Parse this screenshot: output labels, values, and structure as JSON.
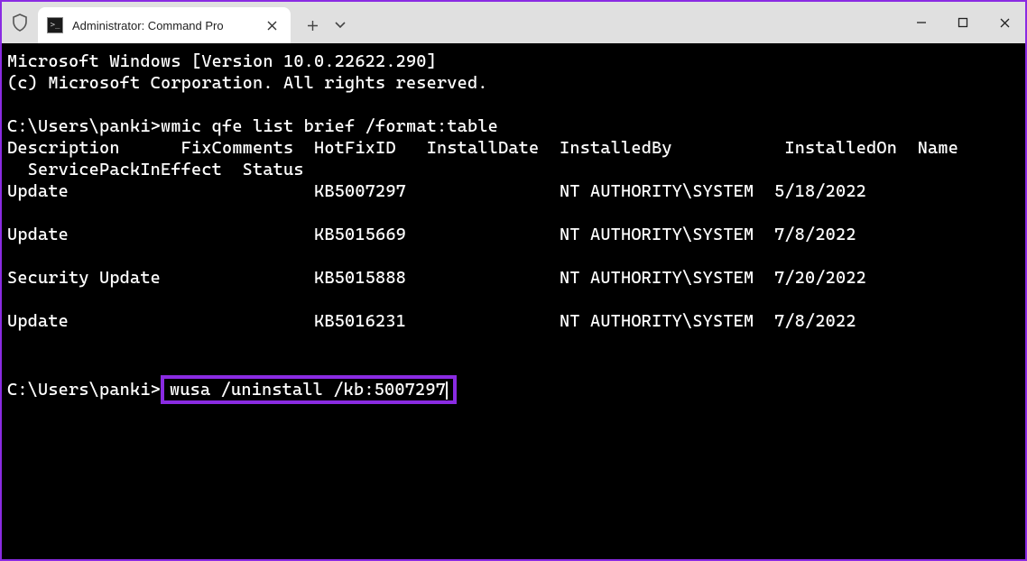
{
  "window": {
    "tab_title": "Administrator: Command Pro",
    "tab_icon": ">_"
  },
  "terminal": {
    "banner1": "Microsoft Windows [Version 10.0.22622.290]",
    "banner2": "(c) Microsoft Corporation. All rights reserved.",
    "prompt1": "C:\\Users\\panki>",
    "command1": "wmic qfe list brief /format:table",
    "headers": {
      "c1": "Description",
      "c2": "FixComments",
      "c3": "HotFixID",
      "c4": "InstallDate",
      "c5": "InstalledBy",
      "c6": "InstalledOn",
      "c7": "Name"
    },
    "headers2": {
      "c1": "ServicePackInEffect",
      "c2": "Status"
    },
    "rows": [
      {
        "desc": "Update",
        "id": "KB5007297",
        "by": "NT AUTHORITY\\SYSTEM",
        "on": "5/18/2022"
      },
      {
        "desc": "Update",
        "id": "KB5015669",
        "by": "NT AUTHORITY\\SYSTEM",
        "on": "7/8/2022"
      },
      {
        "desc": "Security Update",
        "id": "KB5015888",
        "by": "NT AUTHORITY\\SYSTEM",
        "on": "7/20/2022"
      },
      {
        "desc": "Update",
        "id": "KB5016231",
        "by": "NT AUTHORITY\\SYSTEM",
        "on": "7/8/2022"
      }
    ],
    "prompt2": "C:\\Users\\panki>",
    "command2": "wusa /uninstall /kb:5007297"
  }
}
